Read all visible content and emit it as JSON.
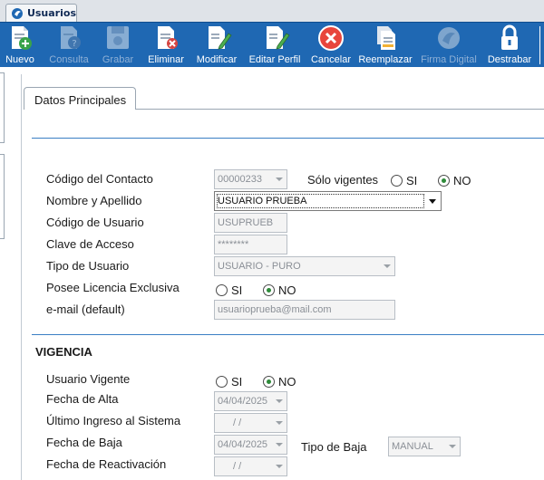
{
  "window_tab": {
    "title": "Usuarios",
    "icon": "app-logo-icon"
  },
  "toolbar": {
    "items": [
      {
        "label": "Nuevo",
        "icon": "new-doc-icon",
        "enabled": true
      },
      {
        "label": "Consulta",
        "icon": "query-doc-icon",
        "enabled": false
      },
      {
        "label": "Grabar",
        "icon": "save-disk-icon",
        "enabled": false
      },
      {
        "label": "Eliminar",
        "icon": "delete-doc-icon",
        "enabled": true
      },
      {
        "label": "Modificar",
        "icon": "edit-doc-icon",
        "enabled": true
      },
      {
        "label": "Editar Perfil",
        "icon": "edit-profile-icon",
        "enabled": true
      },
      {
        "label": "Cancelar",
        "icon": "cancel-icon",
        "enabled": true
      },
      {
        "label": "Reemplazar",
        "icon": "replace-docs-icon",
        "enabled": true
      },
      {
        "label": "Firma Digital",
        "icon": "digital-signature-icon",
        "enabled": false
      },
      {
        "label": "Destrabar",
        "icon": "unlock-icon",
        "enabled": true
      }
    ]
  },
  "panel_tab": "Datos Principales",
  "form": {
    "codigo_contacto": {
      "label": "Código del Contacto",
      "value": "00000233"
    },
    "solo_vigentes": {
      "label": "Sólo vigentes",
      "si": "SI",
      "no": "NO",
      "selected": "NO"
    },
    "nombre_apellido": {
      "label": "Nombre y Apellido",
      "value": "USUARIO PRUEBA"
    },
    "codigo_usuario": {
      "label": "Código de Usuario",
      "value": "USUPRUEB"
    },
    "clave_acceso": {
      "label": "Clave de Acceso",
      "value": "********"
    },
    "tipo_usuario": {
      "label": "Tipo de Usuario",
      "value": "USUARIO - PURO"
    },
    "licencia_exclusiva": {
      "label": "Posee Licencia Exclusiva",
      "si": "SI",
      "no": "NO",
      "selected": "NO"
    },
    "email": {
      "label": "e-mail (default)",
      "value": "usuarioprueba@mail.com"
    }
  },
  "vigencia": {
    "title": "VIGENCIA",
    "usuario_vigente": {
      "label": "Usuario Vigente",
      "si": "SI",
      "no": "NO",
      "selected": "NO"
    },
    "fecha_alta": {
      "label": "Fecha de Alta",
      "value": "04/04/2025"
    },
    "ultimo_ingreso": {
      "label": "Último Ingreso al Sistema",
      "value": "/ /"
    },
    "fecha_baja": {
      "label": "Fecha de Baja",
      "value": "04/04/2025"
    },
    "tipo_baja": {
      "label": "Tipo de Baja",
      "value": "MANUAL"
    },
    "fecha_reactivacion": {
      "label": "Fecha de Reactivación",
      "value": "/ /"
    }
  },
  "colors": {
    "toolbar_bg": "#1f68b3",
    "accent_line": "#3a7fc4",
    "radio_selected": "#2e8b3a"
  }
}
